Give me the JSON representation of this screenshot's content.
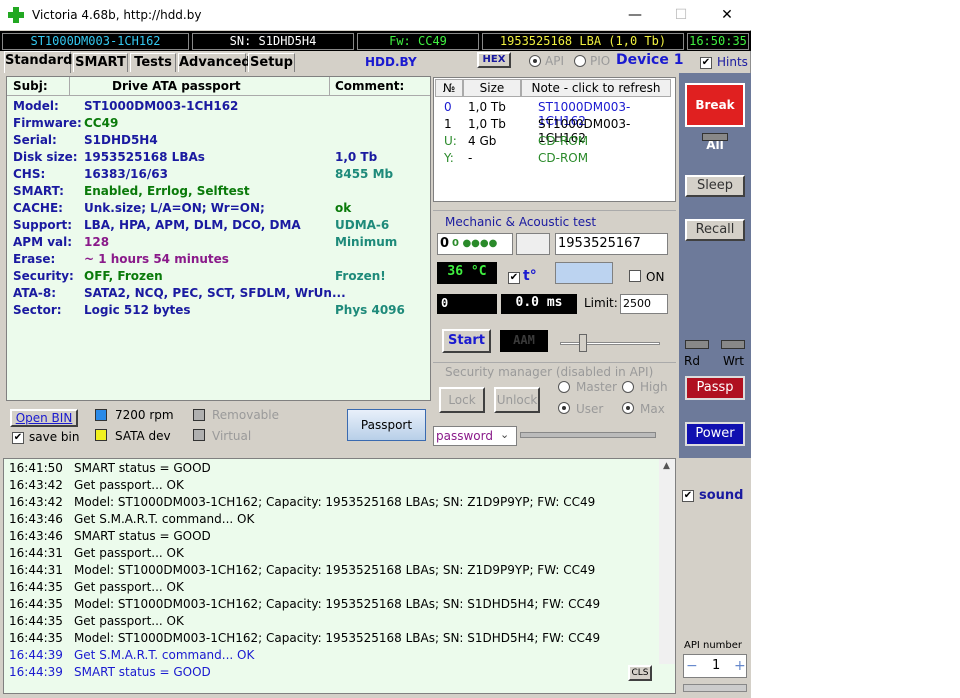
{
  "window": {
    "title": "Victoria 4.68b, http://hdd.by",
    "minimize": "—",
    "maximize": "☐",
    "close": "✕"
  },
  "infobar": {
    "model": "ST1000DM003-1CH162",
    "serial": "SN: S1DHD5H4",
    "firmware": "Fw: CC49",
    "capacity": "1953525168 LBA (1,0 Tb)",
    "time": "16:50:35"
  },
  "tabs": [
    "Standard",
    "SMART",
    "Tests",
    "Advanced",
    "Setup"
  ],
  "top": {
    "hdd_by": "HDD.BY",
    "hex": "HEX",
    "api": "API",
    "pio": "PIO",
    "device": "Device 1",
    "hints": "Hints"
  },
  "passport": {
    "headers": [
      "Subj:",
      "Drive ATA passport",
      "Comment:"
    ],
    "rows": [
      {
        "k": "Model:",
        "v": "ST1000DM003-1CH162",
        "c": ""
      },
      {
        "k": "Firmware:",
        "v": "CC49",
        "c": ""
      },
      {
        "k": "Serial:",
        "v": "S1DHD5H4",
        "c": ""
      },
      {
        "k": "Disk size:",
        "v": "1953525168 LBAs",
        "c": "1,0 Tb"
      },
      {
        "k": "CHS:",
        "v": "16383/16/63",
        "c": "8455 Mb"
      },
      {
        "k": "SMART:",
        "v": "Enabled, Errlog, Selftest",
        "c": ""
      },
      {
        "k": "CACHE:",
        "v": "Unk.size; L/A=ON; Wr=ON;",
        "c": "ok"
      },
      {
        "k": "Support:",
        "v": "LBA, HPA, APM, DLM, DCO, DMA",
        "c": "UDMA-6"
      },
      {
        "k": "APM val:",
        "v": "128",
        "c": "Minimum"
      },
      {
        "k": "Erase:",
        "v": "~ 1 hours 54 minutes",
        "c": ""
      },
      {
        "k": "Security:",
        "v": "OFF, Frozen",
        "c": "Frozen!"
      },
      {
        "k": "ATA-8:",
        "v": "SATA2, NCQ, PEC, SCT, SFDLM, WrUn...",
        "c": ""
      },
      {
        "k": "Sector:",
        "v": "Logic 512 bytes",
        "c": "Phys 4096"
      }
    ]
  },
  "bottom_left": {
    "open_bin": "Open BIN",
    "save_bin": "save bin",
    "rpm": "7200 rpm",
    "sata": "SATA dev",
    "removable": "Removable",
    "virtual": "Virtual",
    "passport_btn": "Passport"
  },
  "drives": {
    "headers": [
      "№",
      "Size",
      "Note - click to refresh"
    ],
    "rows": [
      {
        "n": "0",
        "size": "1,0 Tb",
        "note": "ST1000DM003-1CH162"
      },
      {
        "n": "1",
        "size": "1,0 Tb",
        "note": "ST1000DM003-1CH162"
      },
      {
        "n": "U:",
        "size": "4 Gb",
        "note": "CD-ROM"
      },
      {
        "n": "Y:",
        "size": "-",
        "note": "CD-ROM"
      }
    ]
  },
  "mechanic": {
    "title": "Mechanic & Acoustic test",
    "lba_start": "0",
    "lba_end": "1953525167",
    "temperature": "36 °C",
    "t_label": "t°",
    "on_label": "ON",
    "counter": "0",
    "ms": "0.0 ms",
    "limit_label": "Limit:",
    "limit_value": "2500",
    "start": "Start",
    "aam": "AAM"
  },
  "security": {
    "title": "Security manager (disabled in API)",
    "lock": "Lock",
    "unlock": "Unlock",
    "master": "Master",
    "high": "High",
    "user": "User",
    "max": "Max",
    "password": "password"
  },
  "sidebar": {
    "break_all": "Break All",
    "sleep": "Sleep",
    "recall": "Recall",
    "rd": "Rd",
    "wrt": "Wrt",
    "passp": "Passp",
    "power": "Power",
    "sound": "sound",
    "api_number": "API number",
    "api_value": "1"
  },
  "log": {
    "cls": "CLS",
    "lines": [
      {
        "t": "16:41:50",
        "m": "SMART status = GOOD",
        "blue": false
      },
      {
        "t": "16:43:42",
        "m": "Get passport... OK",
        "blue": false
      },
      {
        "t": "16:43:42",
        "m": "Model: ST1000DM003-1CH162; Capacity: 1953525168 LBAs; SN: Z1D9P9YP; FW: CC49",
        "blue": false
      },
      {
        "t": "16:43:46",
        "m": "Get S.M.A.R.T. command... OK",
        "blue": false
      },
      {
        "t": "16:43:46",
        "m": "SMART status = GOOD",
        "blue": false
      },
      {
        "t": "16:44:31",
        "m": "Get passport... OK",
        "blue": false
      },
      {
        "t": "16:44:31",
        "m": "Model: ST1000DM003-1CH162; Capacity: 1953525168 LBAs; SN: Z1D9P9YP; FW: CC49",
        "blue": false
      },
      {
        "t": "16:44:35",
        "m": "Get passport... OK",
        "blue": false
      },
      {
        "t": "16:44:35",
        "m": "Model: ST1000DM003-1CH162; Capacity: 1953525168 LBAs; SN: S1DHD5H4; FW: CC49",
        "blue": false
      },
      {
        "t": "16:44:35",
        "m": "Get passport... OK",
        "blue": false
      },
      {
        "t": "16:44:35",
        "m": "Model: ST1000DM003-1CH162; Capacity: 1953525168 LBAs; SN: S1DHD5H4; FW: CC49",
        "blue": false
      },
      {
        "t": "16:44:39",
        "m": "Get S.M.A.R.T. command... OK",
        "blue": true
      },
      {
        "t": "16:44:39",
        "m": "SMART status = GOOD",
        "blue": true
      }
    ]
  },
  "colors": {
    "panel_bg": "#ecfbec",
    "accent_blue": "#1a1aa0",
    "break_red": "#e02020",
    "passp_red": "#b01020",
    "power_blue": "#1010b0",
    "sidebar_bg": "#6d7a9a"
  }
}
